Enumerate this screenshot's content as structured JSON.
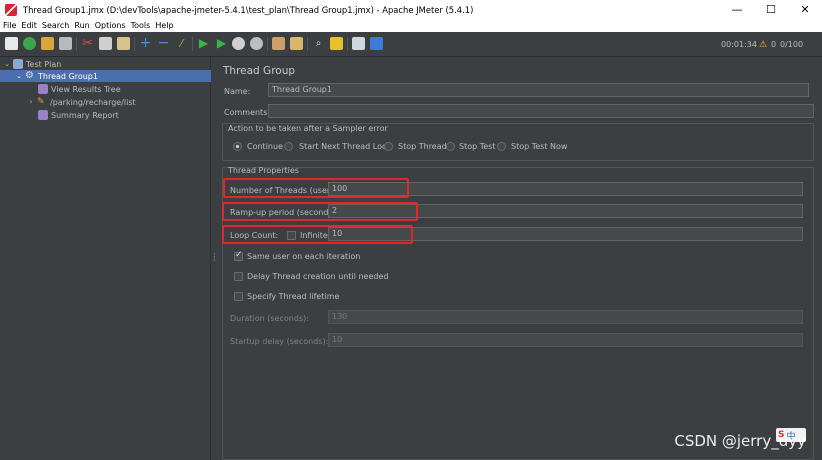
{
  "window": {
    "title": "Thread Group1.jmx (D:\\devTools\\apache-jmeter-5.4.1\\test_plan\\Thread Group1.jmx) - Apache JMeter (5.4.1)",
    "minimize": "—",
    "maximize": "☐",
    "close": "✕"
  },
  "menu": {
    "file": "File",
    "edit": "Edit",
    "search": "Search",
    "run": "Run",
    "options": "Options",
    "tools": "Tools",
    "help": "Help"
  },
  "toolbar": {
    "elapsed": "00:01:34",
    "warnings": "0",
    "threads": "0/100",
    "warning_color": "#e8c02a"
  },
  "tree": {
    "items": [
      {
        "label": "Test Plan",
        "icon": "test-plan-icon"
      },
      {
        "label": "Thread Group1",
        "icon": "gear-icon"
      },
      {
        "label": "View Results Tree",
        "icon": "listener-icon"
      },
      {
        "label": "/parking/recharge/list",
        "icon": "sampler-icon"
      },
      {
        "label": "Summary Report",
        "icon": "listener-icon"
      }
    ],
    "selected_color": "#4b6eaf"
  },
  "panel": {
    "heading": "Thread Group",
    "name_label": "Name:",
    "name_value": "Thread Group1",
    "comments_label": "Comments:",
    "comments_value": "",
    "error_action": {
      "label": "Action to be taken after a Sampler error",
      "options": [
        "Continue",
        "Start Next Thread Loop",
        "Stop Thread",
        "Stop Test",
        "Stop Test Now"
      ],
      "selected": "Continue"
    },
    "thread_props": {
      "label": "Thread Properties",
      "num_threads_label": "Number of Threads (users):",
      "num_threads_value": "100",
      "rampup_label": "Ramp-up period (seconds):",
      "rampup_value": "2",
      "loop_label": "Loop Count:",
      "infinite_label": "Infinite",
      "loop_value": "10",
      "same_user_label": "Same user on each iteration",
      "delay_label": "Delay Thread creation until needed",
      "lifetime_label": "Specify Thread lifetime",
      "duration_label": "Duration (seconds):",
      "duration_value": "130",
      "startup_label": "Startup delay (seconds):",
      "startup_value": "10"
    },
    "highlight_color": "#e0282a"
  },
  "watermark": "CSDN @jerry_dyy",
  "ime": {
    "logo": "S",
    "text": "中"
  }
}
